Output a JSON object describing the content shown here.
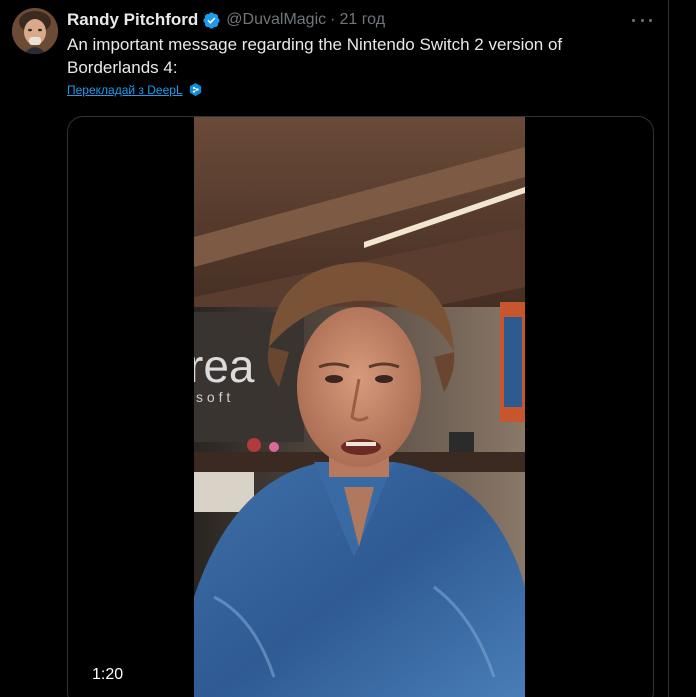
{
  "tweet": {
    "author_name": "Randy Pitchford",
    "handle": "@DuvalMagic",
    "separator": "·",
    "timestamp": "21 год",
    "text": "An important message regarding the Nintendo Switch 2 version of Borderlands 4:",
    "translate_label": "Перекладай з DeepL",
    "verified": true
  },
  "media": {
    "type": "video",
    "duration": "1:20",
    "background_sign_text": "rea",
    "background_sign_subtext": "s o f t"
  },
  "icons": {
    "verified": "verified-badge-icon",
    "more": "more-options-icon",
    "deepl": "deepl-icon"
  },
  "colors": {
    "background": "#000000",
    "text_primary": "#e7e9ea",
    "text_secondary": "#71767b",
    "accent_blue": "#1d9bf0",
    "border": "#2f3336"
  }
}
